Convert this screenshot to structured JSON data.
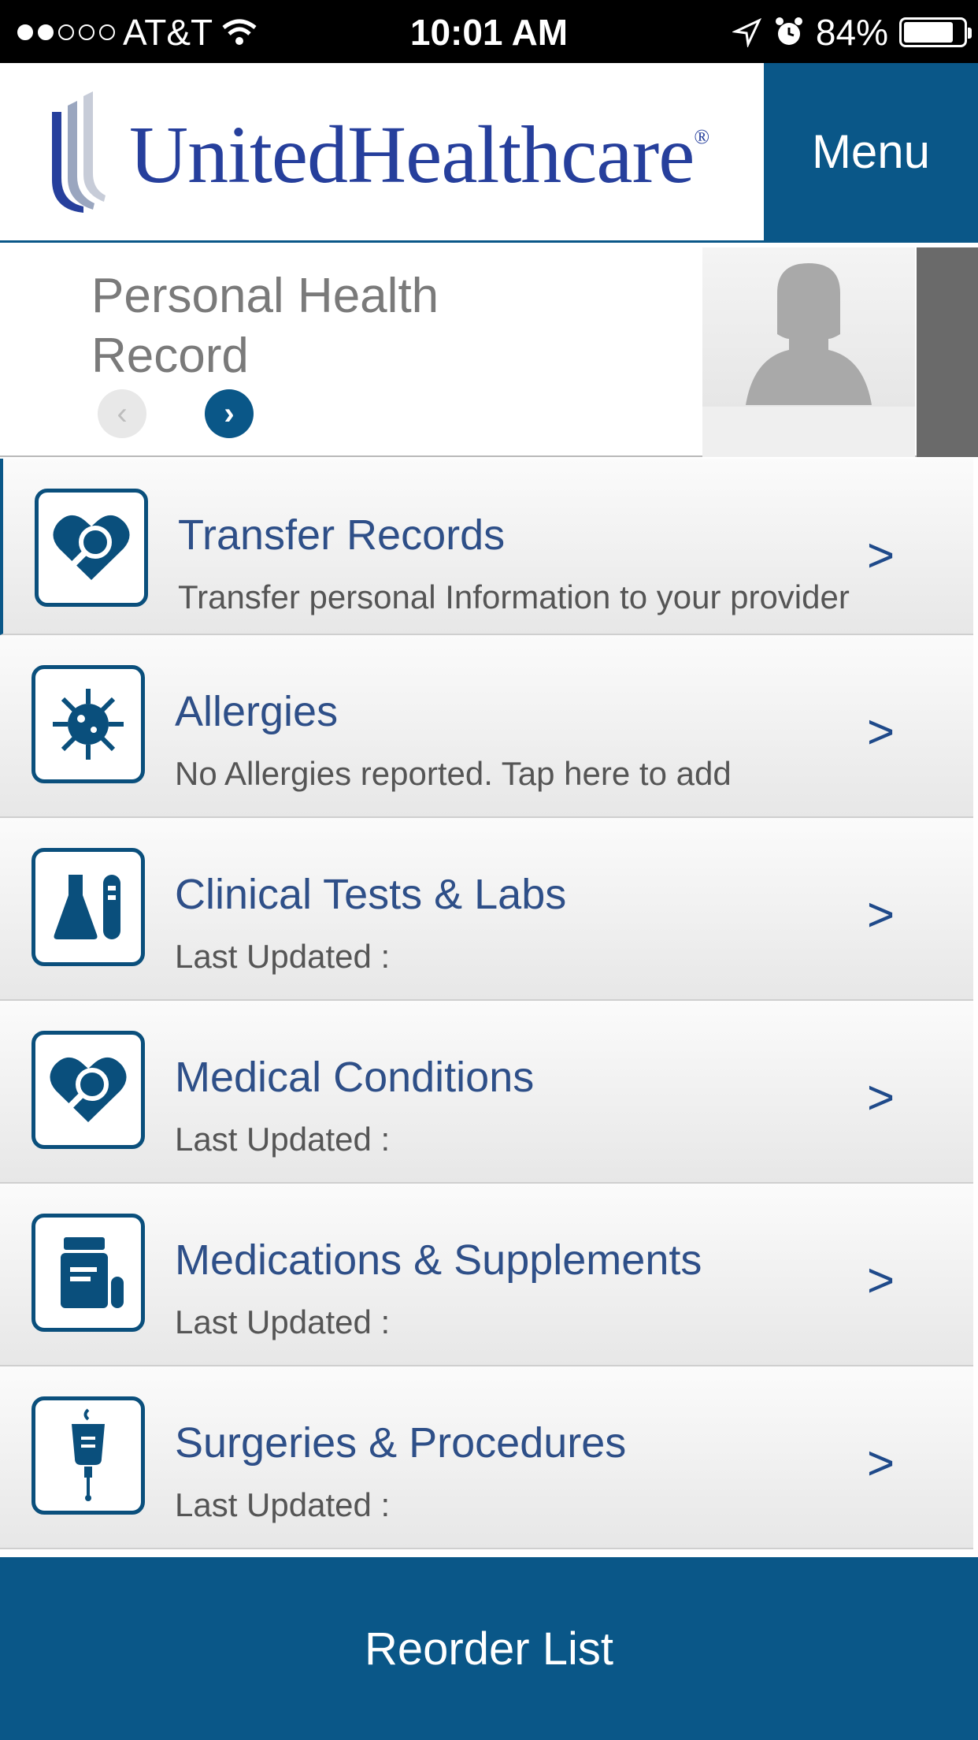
{
  "status_bar": {
    "carrier": "AT&T",
    "time": "10:01 AM",
    "battery": "84%",
    "battery_level": 0.84,
    "signal_bars_filled": 2,
    "signal_bars_total": 5
  },
  "header": {
    "logo_text": "UnitedHealthcare",
    "logo_mark": "®",
    "menu_label": "Menu",
    "accent_color": "#0a5788",
    "brand_color": "#263f9c"
  },
  "phr": {
    "title": "Personal Health Record",
    "prev_icon": "chevron-left-icon",
    "next_icon": "chevron-right-icon"
  },
  "records": [
    {
      "title": "Transfer Records",
      "subtitle": "Transfer personal Information to your provider",
      "icon": "heart-magnifier-icon"
    },
    {
      "title": "Allergies",
      "subtitle": "No Allergies reported. Tap here to add",
      "icon": "allergen-virus-icon"
    },
    {
      "title": "Clinical Tests & Labs",
      "subtitle": "Last Updated :",
      "icon": "lab-flask-icon"
    },
    {
      "title": "Medical Conditions",
      "subtitle": "Last Updated :",
      "icon": "heart-magnifier-icon"
    },
    {
      "title": "Medications & Supplements",
      "subtitle": "Last Updated :",
      "icon": "pill-bottle-icon"
    },
    {
      "title": "Surgeries & Procedures",
      "subtitle": "Last Updated :",
      "icon": "iv-bag-icon"
    }
  ],
  "chevron": ">",
  "footer": {
    "reorder_label": "Reorder List"
  }
}
